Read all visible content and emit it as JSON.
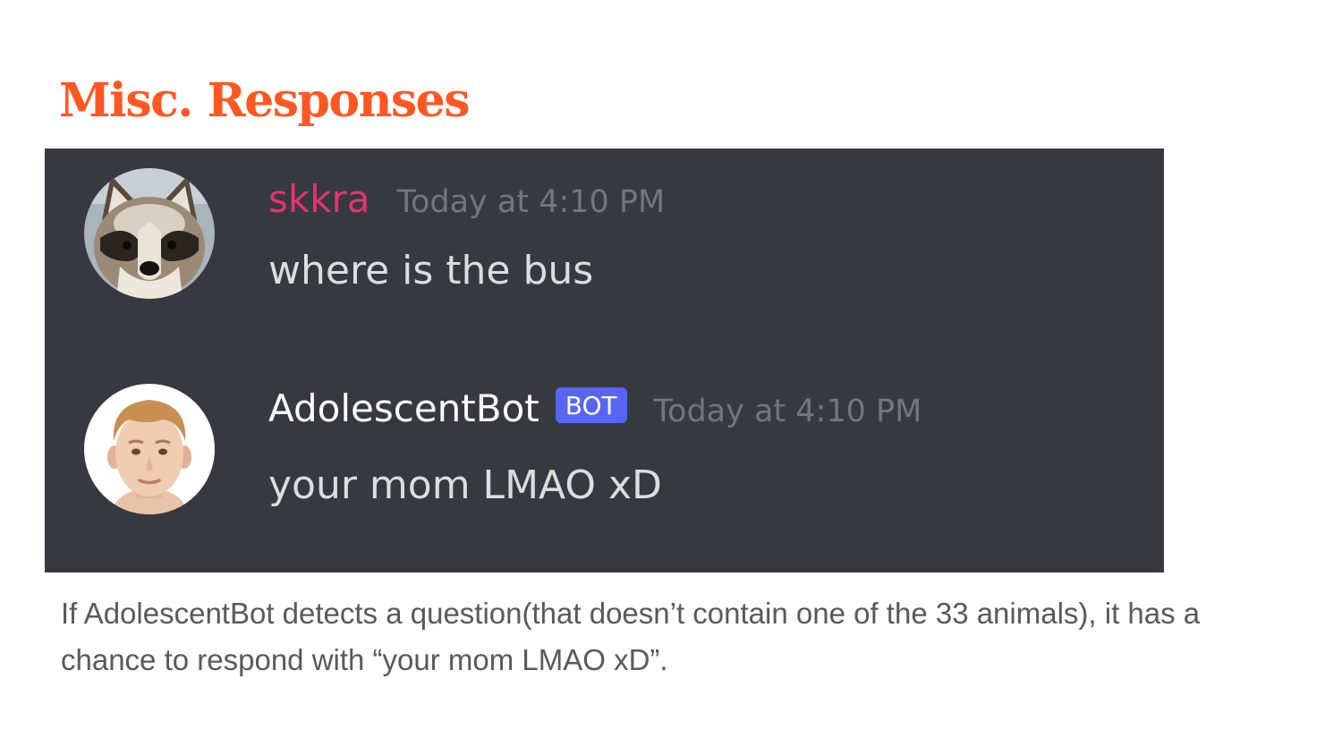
{
  "slide": {
    "title": "Misc. Responses",
    "caption": "If AdolescentBot detects a question(that doesn’t contain one of the 33 animals), it has a chance to respond with “your mom LMAO xD”."
  },
  "chat": {
    "messages": [
      {
        "username": "skkra",
        "timestamp": "Today at 4:10 PM",
        "text": "where is the bus",
        "avatar_icon": "raccoon-avatar"
      },
      {
        "username": "AdolescentBot",
        "tag": "BOT",
        "timestamp": "Today at 4:10 PM",
        "text": "your mom LMAO xD",
        "avatar_icon": "boy-avatar"
      }
    ]
  },
  "colors": {
    "title": "#ff5722",
    "chat_background": "#36393f",
    "username_skkra": "#e8336d",
    "bot_tag": "#5865f2",
    "timestamp": "#72767d",
    "message_text": "#dcddde",
    "caption": "#595959"
  }
}
